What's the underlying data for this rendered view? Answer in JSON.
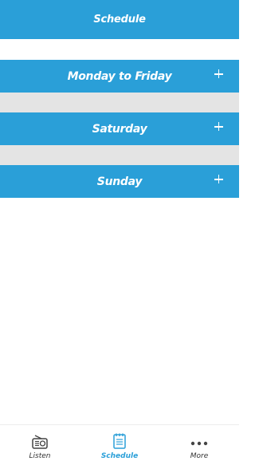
{
  "header": {
    "title": "Schedule"
  },
  "sections": [
    {
      "label": "Monday to Friday"
    },
    {
      "label": "Saturday"
    },
    {
      "label": "Sunday"
    }
  ],
  "tabbar": {
    "tabs": [
      {
        "label": "Listen",
        "icon": "radio-icon",
        "active": false
      },
      {
        "label": "Schedule",
        "icon": "schedule-icon",
        "active": true
      },
      {
        "label": "More",
        "icon": "more-dots-icon",
        "active": false
      }
    ]
  },
  "colors": {
    "primary": "#2a9fd8",
    "separator": "#e4e4e4"
  }
}
